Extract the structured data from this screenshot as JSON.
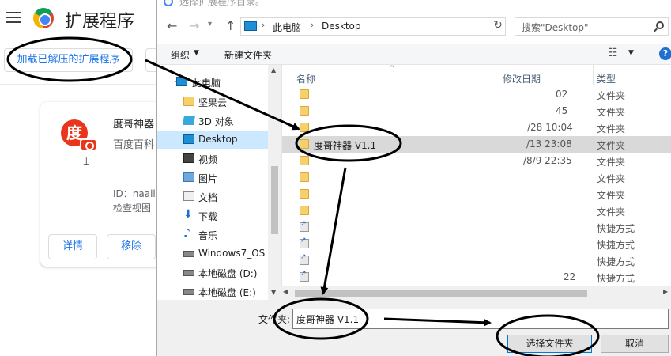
{
  "chrome": {
    "title": "扩展程序",
    "load_unpacked": "加载已解压的扩展程序",
    "extension": {
      "icon_char": "度",
      "name": "度哥神器",
      "description": "百度百科",
      "id_label": "ID：naail",
      "inspect_label": "检查视图",
      "details_button": "详情",
      "remove_button": "移除"
    }
  },
  "dialog": {
    "title": "选择扩展程序目录。",
    "address": {
      "crumbs": [
        "此电脑",
        "Desktop"
      ]
    },
    "search_placeholder": "搜索\"Desktop\"",
    "command_bar": {
      "organize": "组织",
      "new_folder": "新建文件夹"
    },
    "nav_tree": [
      {
        "label": "此电脑",
        "icon": "pc-icon"
      },
      {
        "label": "坚果云",
        "icon": "folder-icon"
      },
      {
        "label": "3D 对象",
        "icon": "3d-objects-icon"
      },
      {
        "label": "Desktop",
        "icon": "desktop-icon"
      },
      {
        "label": "视频",
        "icon": "video-icon"
      },
      {
        "label": "图片",
        "icon": "pictures-icon"
      },
      {
        "label": "文档",
        "icon": "documents-icon"
      },
      {
        "label": "下载",
        "icon": "download-icon"
      },
      {
        "label": "音乐",
        "icon": "music-icon"
      },
      {
        "label": "Windows7_OS",
        "icon": "drive-icon"
      },
      {
        "label": "本地磁盘 (D:)",
        "icon": "drive-icon"
      },
      {
        "label": "本地磁盘 (E:)",
        "icon": "drive-icon"
      }
    ],
    "columns": {
      "name": "名称",
      "date": "修改日期",
      "type": "类型"
    },
    "files": [
      {
        "name": "",
        "date": "02",
        "type": "文件夹",
        "icon": "folder-icon"
      },
      {
        "name": "",
        "date": "45",
        "type": "文件夹",
        "icon": "folder-icon"
      },
      {
        "name": "",
        "date": "/28 10:04",
        "type": "文件夹",
        "icon": "folder-icon"
      },
      {
        "name": "度哥神器 V1.1",
        "date": "/13 23:08",
        "type": "文件夹",
        "icon": "folder-icon"
      },
      {
        "name": "",
        "date": "/8/9 22:35",
        "type": "文件夹",
        "icon": "folder-icon"
      },
      {
        "name": "",
        "date": "",
        "type": "文件夹",
        "icon": "folder-icon"
      },
      {
        "name": "",
        "date": "",
        "type": "文件夹",
        "icon": "folder-icon"
      },
      {
        "name": "",
        "date": "",
        "type": "文件夹",
        "icon": "folder-icon"
      },
      {
        "name": "",
        "date": "",
        "type": "快捷方式",
        "icon": "shortcut-icon"
      },
      {
        "name": "",
        "date": "",
        "type": "快捷方式",
        "icon": "shortcut-icon"
      },
      {
        "name": "",
        "date": "",
        "type": "快捷方式",
        "icon": "shortcut-icon"
      },
      {
        "name": "",
        "date": "22",
        "type": "快捷方式",
        "icon": "shortcut-icon"
      }
    ],
    "folder_field": {
      "label": "文件夹:",
      "value": "度哥神器 V1.1"
    },
    "buttons": {
      "select_folder": "选择文件夹",
      "cancel": "取消"
    }
  },
  "colors": {
    "accent": "#1a73e8",
    "selection": "#cce8ff",
    "annotation": "#000000"
  }
}
